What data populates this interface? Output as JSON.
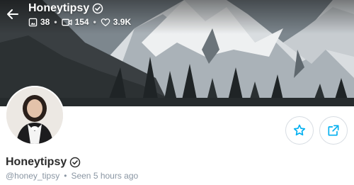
{
  "profile": {
    "name": "Honeytipsy",
    "handle": "@honey_tipsy",
    "seen_label": "Seen",
    "seen_time": "5 hours ago"
  },
  "stats": {
    "photos": "38",
    "videos": "154",
    "likes": "3.9K",
    "separator": "•"
  },
  "icons": {
    "back": "arrow-left-icon",
    "verified": "verified-badge-icon",
    "photos": "image-icon",
    "videos": "video-icon",
    "likes": "heart-icon",
    "favorite": "star-icon",
    "share": "share-icon"
  },
  "colors": {
    "accent": "#00aff0",
    "muted": "#8a96a3",
    "text": "#2b2b2b"
  }
}
